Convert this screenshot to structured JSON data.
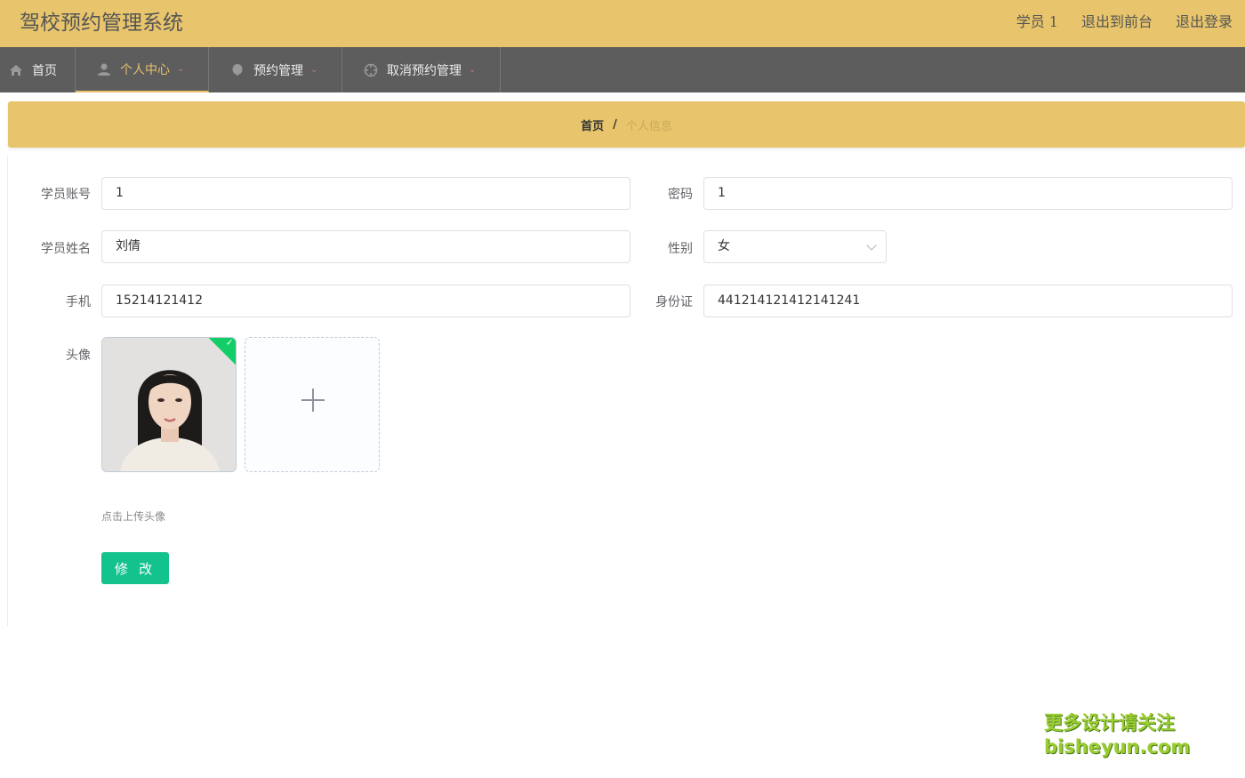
{
  "header": {
    "title": "驾校预约管理系统",
    "user": "学员 1",
    "front_link": "退出到前台",
    "logout_link": "退出登录"
  },
  "nav": {
    "home": "首页",
    "personal": "个人中心",
    "booking": "预约管理",
    "cancel": "取消预约管理"
  },
  "breadcrumb": {
    "home": "首页",
    "sep": "/",
    "current": "个人信息"
  },
  "form": {
    "account_label": "学员账号",
    "account_value": "1",
    "password_label": "密码",
    "password_value": "1",
    "name_label": "学员姓名",
    "name_value": "刘倩",
    "gender_label": "性别",
    "gender_value": "女",
    "phone_label": "手机",
    "phone_value": "15214121412",
    "id_label": "身份证",
    "id_value": "441214121412141241",
    "avatar_label": "头像",
    "upload_tip": "点击上传头像",
    "submit_label": "修 改"
  },
  "watermark": {
    "line1": "更多设计请关注",
    "line2": "bisheyun.com"
  },
  "colors": {
    "header_bg": "#e8c56c",
    "nav_bg": "#5d5d5d",
    "accent": "#e6c16a",
    "button": "#13c28d",
    "success": "#13ce66"
  }
}
